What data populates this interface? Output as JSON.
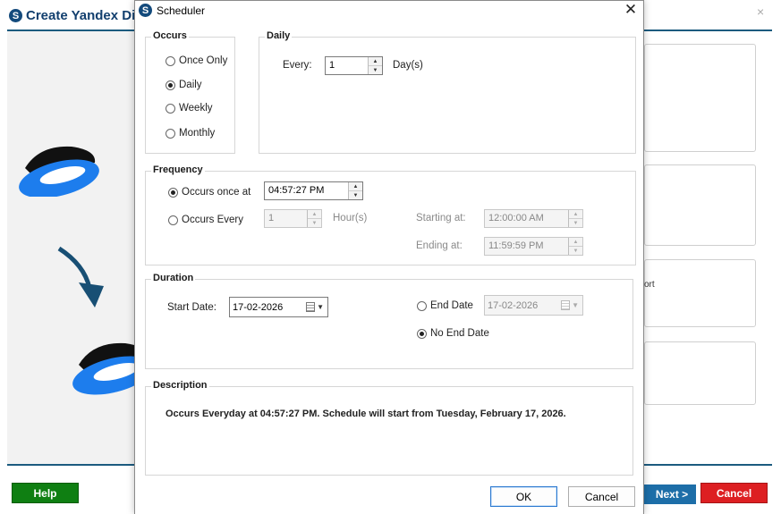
{
  "background": {
    "title": "Create Yandex Dis",
    "logo_letter": "S",
    "close_glyph": "×",
    "partial_text": "ort",
    "help_label": "Help",
    "next_label": "Next >",
    "cancel_label": "Cancel",
    "colors": {
      "help": "#0f7f12",
      "cancel": "#dd1f22",
      "next": "#1d6ea8",
      "accent": "#1c5b7f",
      "cloud_blue": "#1d7ded"
    }
  },
  "dialog": {
    "title": "Scheduler",
    "logo_letter": "S",
    "close_glyph": "✕",
    "occurs": {
      "title": "Occurs",
      "options": [
        "Once Only",
        "Daily",
        "Weekly",
        "Monthly"
      ],
      "selected": "Daily"
    },
    "daily": {
      "title": "Daily",
      "every_label": "Every:",
      "every_value": "1",
      "unit": "Day(s)"
    },
    "frequency": {
      "title": "Frequency",
      "once_label": "Occurs once at",
      "once_value": "04:57:27 PM",
      "every_label": "Occurs Every",
      "every_value": "1",
      "every_unit": "Hour(s)",
      "starting_label": "Starting at:",
      "starting_value": "12:00:00 AM",
      "ending_label": "Ending at:",
      "ending_value": "11:59:59 PM"
    },
    "duration": {
      "title": "Duration",
      "start_label": "Start Date:",
      "start_value": "17-02-2026",
      "end_date_label": "End Date",
      "end_date_value": "17-02-2026",
      "no_end_label": "No End Date",
      "selected": "No End Date"
    },
    "description": {
      "title": "Description",
      "text": "Occurs Everyday at 04:57:27 PM. Schedule will start from Tuesday, February 17, 2026."
    },
    "ok_label": "OK",
    "cancel_label": "Cancel"
  }
}
